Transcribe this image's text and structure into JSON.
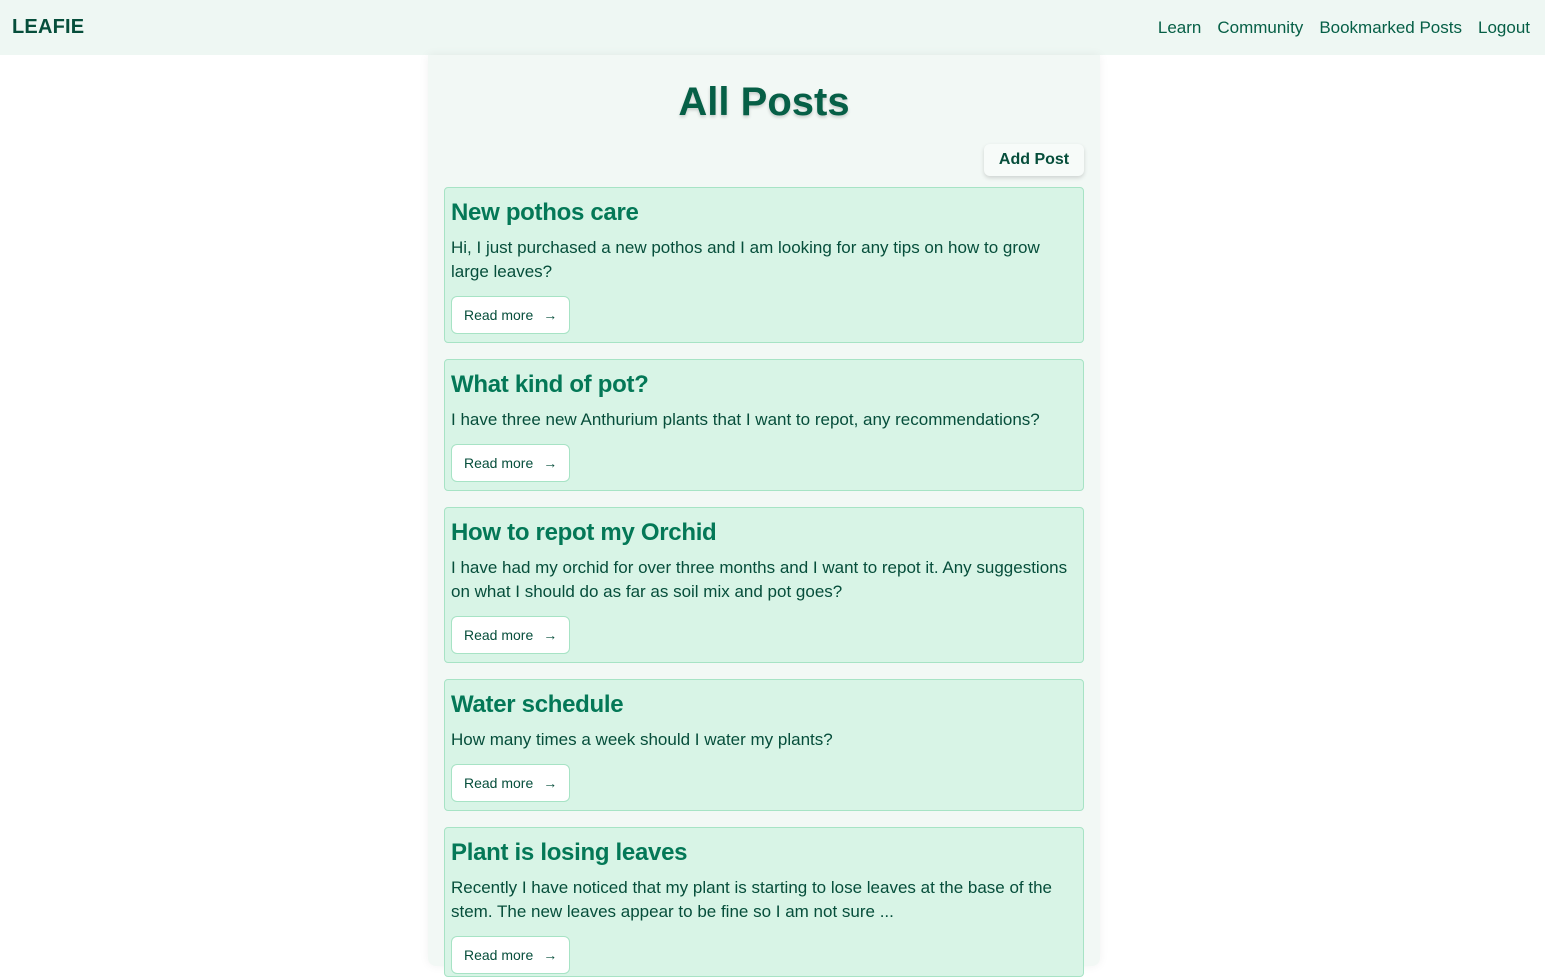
{
  "nav": {
    "brand": "LEAFIE",
    "links": [
      "Learn",
      "Community",
      "Bookmarked Posts",
      "Logout"
    ]
  },
  "page": {
    "title": "All Posts",
    "add_post_label": "Add Post"
  },
  "posts": [
    {
      "title": "New pothos care",
      "body": "Hi, I just purchased a new pothos and I am looking for any tips on how to grow large leaves?",
      "read_more": "Read more"
    },
    {
      "title": "What kind of pot?",
      "body": "I have three new Anthurium plants that I want to repot, any recommendations?",
      "read_more": "Read more"
    },
    {
      "title": "How to repot my Orchid",
      "body": "I have had my orchid for over three months and I want to repot it. Any suggestions on what I should do as far as soil mix and pot goes?",
      "read_more": "Read more"
    },
    {
      "title": "Water schedule",
      "body": "How many times a week should I water my plants?",
      "read_more": "Read more"
    },
    {
      "title": "Plant is losing leaves",
      "body": "Recently I have noticed that my plant is starting to lose leaves at the base of the stem. The new leaves appear to be fine so I am not sure ...",
      "read_more": "Read more"
    }
  ],
  "icons": {
    "read_more_arrow": "arrow-right-icon"
  },
  "colors": {
    "nav_bg": "#eef7f3",
    "panel_bg": "#f2f8f5",
    "card_bg": "#d8f4e6",
    "card_border": "#a7e3c5",
    "title_green": "#065f46",
    "post_title_green": "#047857",
    "text_dark": "#064e3b"
  }
}
